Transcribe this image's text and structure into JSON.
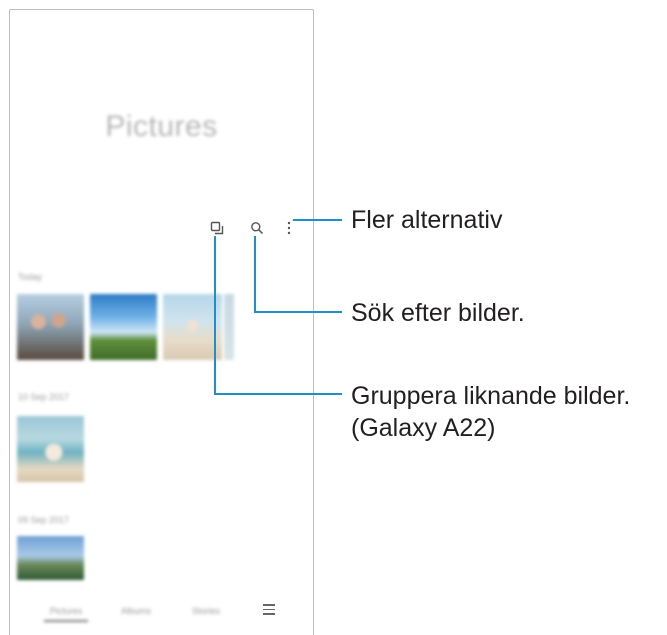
{
  "app": {
    "title": "Pictures"
  },
  "sections": [
    {
      "label": "Today"
    },
    {
      "label": "10 Sep 2017"
    },
    {
      "label": "09 Sep 2017"
    }
  ],
  "bottom_nav": {
    "items": [
      "Pictures",
      "Albums",
      "Stories"
    ],
    "menu_icon": "hamburger-menu-icon"
  },
  "toolbar": {
    "icons": [
      "group-similar-icon",
      "search-icon",
      "more-options-icon"
    ]
  },
  "callouts": {
    "more_options": "Fler alternativ",
    "search": "Sök efter bilder.",
    "group_line1": "Gruppera liknande bilder.",
    "group_line2": "(Galaxy A22)"
  },
  "colors": {
    "callout_line": "#1f8fc4",
    "text": "#231f20"
  }
}
